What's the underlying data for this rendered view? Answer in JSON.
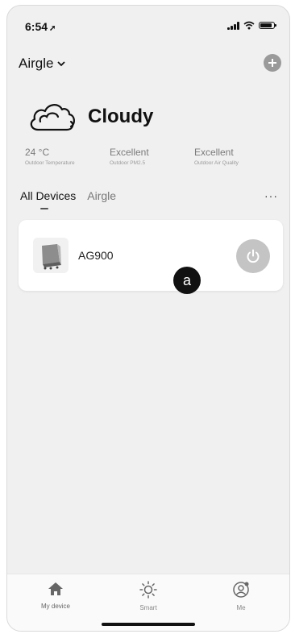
{
  "status_bar": {
    "time": "6:54"
  },
  "header": {
    "home_name": "Airgle"
  },
  "weather": {
    "condition": "Cloudy",
    "stats": [
      {
        "value": "24 °C",
        "label": "Outdoor Temperature"
      },
      {
        "value": "Excellent",
        "label": "Outdoor PM2.5"
      },
      {
        "value": "Excellent",
        "label": "Outdoor Air Quality"
      }
    ]
  },
  "tabs": [
    {
      "label": "All Devices",
      "active": true
    },
    {
      "label": "Airgle",
      "active": false
    }
  ],
  "more_label": "···",
  "devices": [
    {
      "name": "AG900",
      "power_on": false
    }
  ],
  "annotation_marker": "a",
  "bottom_nav": [
    {
      "label": "My device",
      "icon": "home-icon",
      "active": true
    },
    {
      "label": "Smart",
      "icon": "sun-icon",
      "active": false
    },
    {
      "label": "Me",
      "icon": "profile-icon",
      "active": false
    }
  ],
  "colors": {
    "background": "#f0f0f0",
    "card": "#ffffff",
    "power_button": "#c4c4c4",
    "accent": "#111111"
  }
}
